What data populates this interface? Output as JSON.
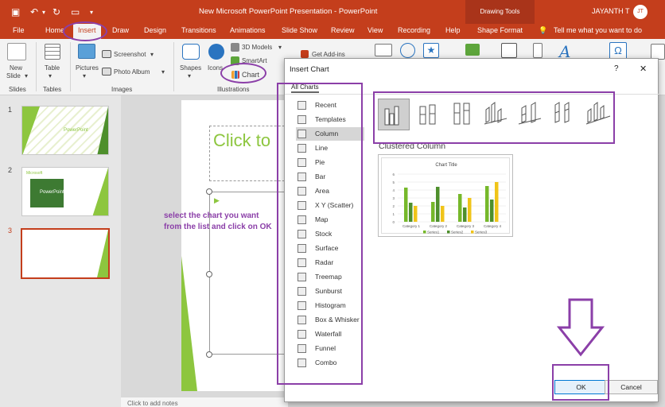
{
  "titlebar": {
    "title": "New Microsoft PowerPoint Presentation - PowerPoint",
    "context_tab": "Drawing Tools",
    "user": "JAYANTH T",
    "avatar": "JT"
  },
  "tabs": [
    {
      "label": "File"
    },
    {
      "label": "Home"
    },
    {
      "label": "Insert"
    },
    {
      "label": "Draw"
    },
    {
      "label": "Design"
    },
    {
      "label": "Transitions"
    },
    {
      "label": "Animations"
    },
    {
      "label": "Slide Show"
    },
    {
      "label": "Review"
    },
    {
      "label": "View"
    },
    {
      "label": "Recording"
    },
    {
      "label": "Help"
    },
    {
      "label": "Shape Format"
    }
  ],
  "tell_me": "Tell me what you want to do",
  "ribbon": {
    "new_slide_1": "New",
    "new_slide_2": "Slide",
    "table": "Table",
    "pictures": "Pictures",
    "screenshot": "Screenshot",
    "photo_album": "Photo Album",
    "shapes": "Shapes",
    "icons": "Icons",
    "models3d": "3D Models",
    "smartart": "SmartArt",
    "chart": "Chart",
    "get_addins": "Get Add-ins",
    "groups": {
      "slides": "Slides",
      "tables": "Tables",
      "images": "Images",
      "illustrations": "Illustrations"
    }
  },
  "slides": [
    {
      "num": "1"
    },
    {
      "num": "2"
    },
    {
      "num": "3"
    }
  ],
  "thumb_text": {
    "s1_title": "PowerPoint",
    "s2_title": "PowerPoint",
    "s2_small": "Microsoft"
  },
  "slide_title_placeholder": "Click to",
  "notes_placeholder": "Click to add notes",
  "annotation_text": "select the chart you want from the list and click on OK",
  "dialog": {
    "title": "Insert Chart",
    "help": "?",
    "close": "✕",
    "all_charts_tab": "All Charts",
    "chart_types": [
      {
        "label": "Recent"
      },
      {
        "label": "Templates"
      },
      {
        "label": "Column"
      },
      {
        "label": "Line"
      },
      {
        "label": "Pie"
      },
      {
        "label": "Bar"
      },
      {
        "label": "Area"
      },
      {
        "label": "X Y (Scatter)"
      },
      {
        "label": "Map"
      },
      {
        "label": "Stock"
      },
      {
        "label": "Surface"
      },
      {
        "label": "Radar"
      },
      {
        "label": "Treemap"
      },
      {
        "label": "Sunburst"
      },
      {
        "label": "Histogram"
      },
      {
        "label": "Box & Whisker"
      },
      {
        "label": "Waterfall"
      },
      {
        "label": "Funnel"
      },
      {
        "label": "Combo"
      }
    ],
    "selected_subtype": "Clustered Column",
    "ok": "OK",
    "cancel": "Cancel"
  },
  "preview_chart": {
    "title": "Chart Title",
    "y_ticks": [
      "6",
      "5",
      "4",
      "3",
      "2",
      "1",
      "0"
    ]
  },
  "chart_data": {
    "type": "bar",
    "title": "Chart Title",
    "categories": [
      "Category 1",
      "Category 2",
      "Category 3",
      "Category 4"
    ],
    "series": [
      {
        "name": "Series1",
        "values": [
          4.3,
          2.5,
          3.5,
          4.5
        ],
        "color": "#76b82a"
      },
      {
        "name": "Series2",
        "values": [
          2.4,
          4.4,
          1.8,
          2.8
        ],
        "color": "#4e8f2c"
      },
      {
        "name": "Series3",
        "values": [
          2,
          2,
          3,
          5
        ],
        "color": "#f0c419"
      }
    ],
    "ylim": [
      0,
      6
    ],
    "legend": "bottom"
  },
  "colors": {
    "accent": "#c43e1c",
    "annotation": "#8b3fa8",
    "slide_green": "#8dc63f"
  }
}
